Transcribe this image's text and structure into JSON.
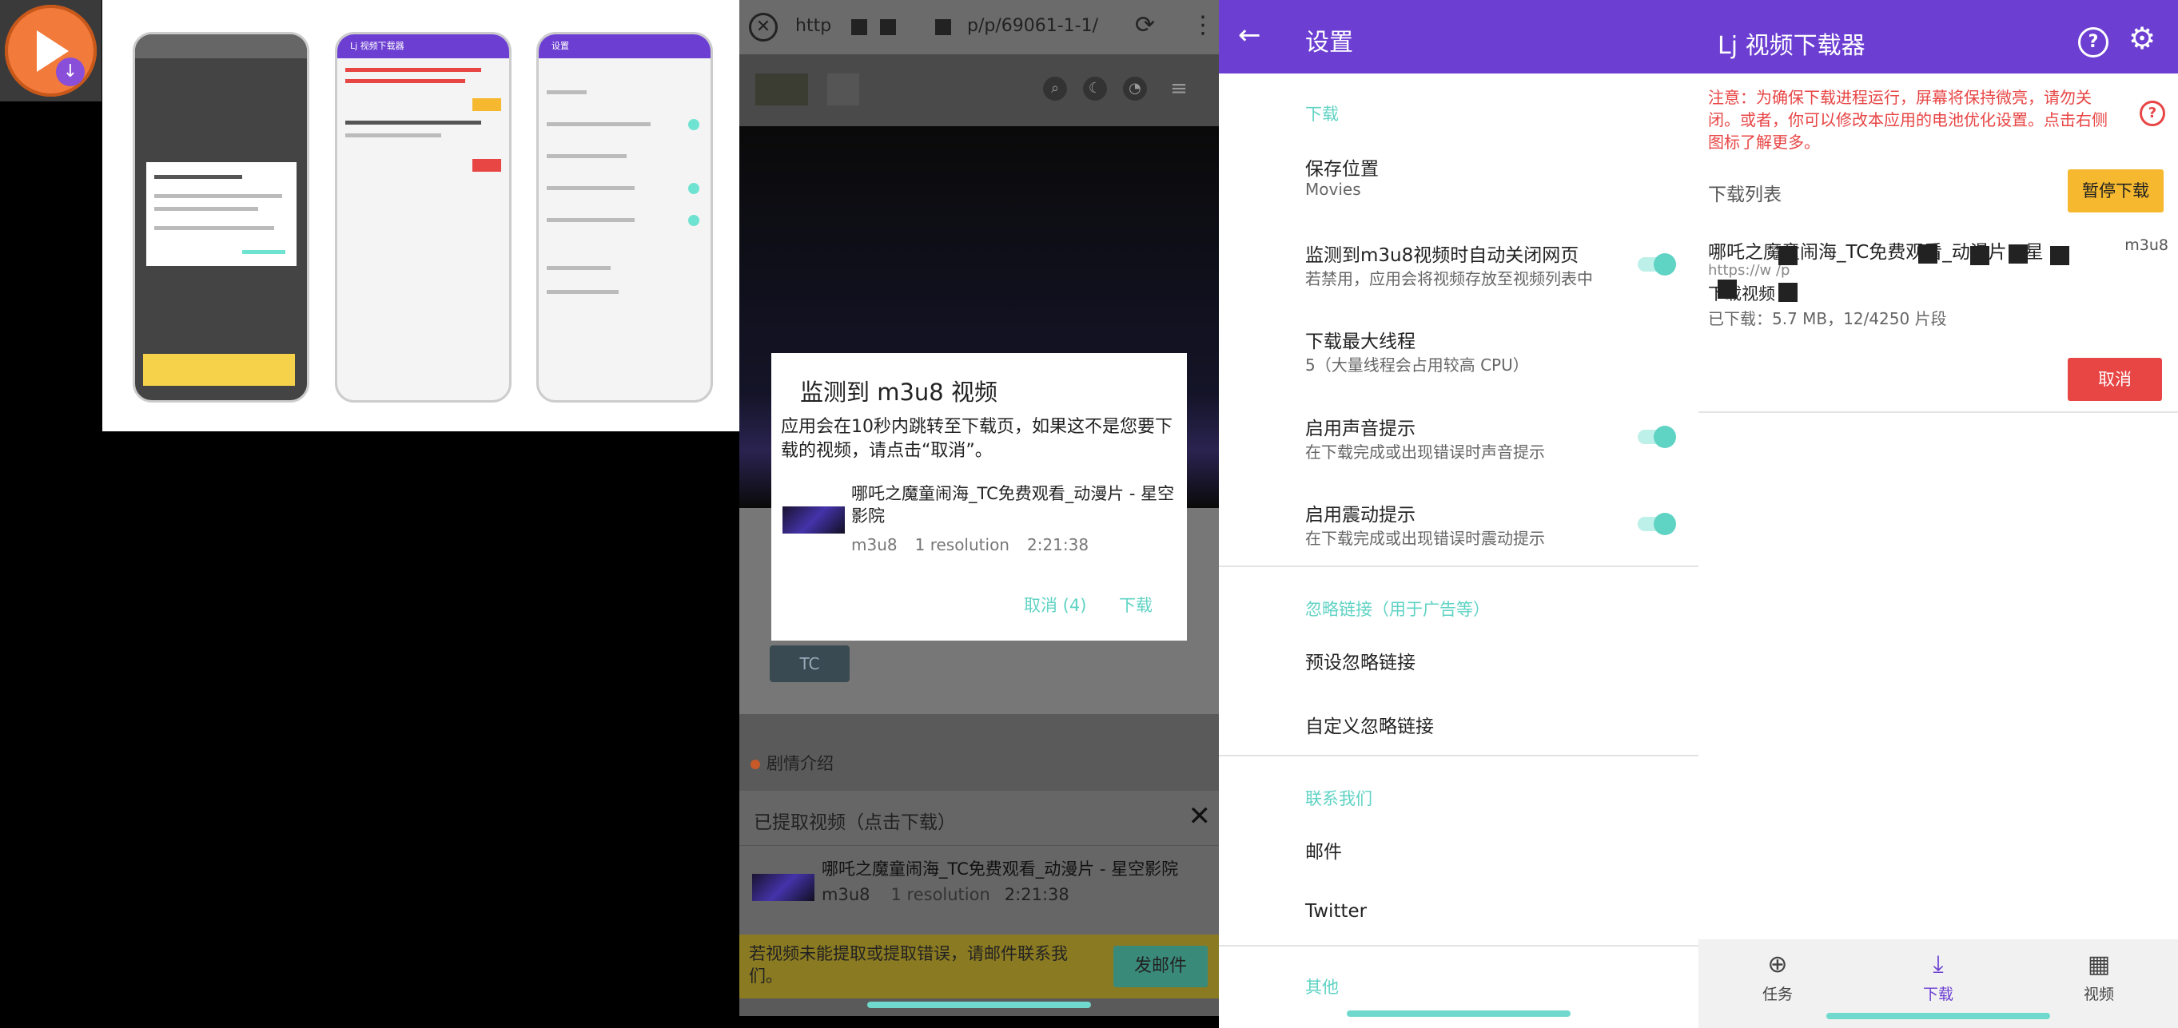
{
  "preview": {
    "p1_bar": "",
    "p2_bar": "Lj 视频下载器",
    "p3_bar": "设置"
  },
  "browser": {
    "url_prefix": "http",
    "url_suffix": "p/p/69061-1-1/",
    "tc_button": "TC",
    "synopsis": "剧情介绍",
    "extracted_header": "已提取视频（点击下载）",
    "video": {
      "title": "哪吒之魔童闹海_TC免费观看_动漫片 - 星空影院",
      "title_wrapped": "哪吒之魔童闹海_TC免费观看_动漫片 - 星空影院",
      "format": "m3u8",
      "resolution": "1 resolution",
      "duration": "2:21:38"
    },
    "warning": "若视频未能提取或提取错误，请邮件联系我们。",
    "email_button": "发邮件"
  },
  "dialog": {
    "title": "监测到 m3u8 视频",
    "message": "应用会在10秒内跳转至下载页，如果这不是您要下载的视频，请点击“取消”。",
    "cancel": "取消 (4)",
    "download": "下载"
  },
  "settings": {
    "title": "设置",
    "sections": {
      "download": "下载",
      "ignore": "忽略链接（用于广告等）",
      "contact": "联系我们",
      "other": "其他"
    },
    "items": {
      "save_location": {
        "title": "保存位置",
        "sub": "Movies"
      },
      "auto_close": {
        "title": "监测到m3u8视频时自动关闭网页",
        "sub": "若禁用，应用会将视频存放至视频列表中"
      },
      "max_threads": {
        "title": "下载最大线程",
        "sub": "5（大量线程会占用较高 CPU）"
      },
      "sound": {
        "title": "启用声音提示",
        "sub": "在下载完成或出现错误时声音提示"
      },
      "vibrate": {
        "title": "启用震动提示",
        "sub": "在下载完成或出现错误时震动提示"
      },
      "preset_ignore": {
        "title": "预设忽略链接"
      },
      "custom_ignore": {
        "title": "自定义忽略链接"
      },
      "email": {
        "title": "邮件"
      },
      "twitter": {
        "title": "Twitter"
      }
    }
  },
  "main": {
    "title": "Lj 视频下载器",
    "notice": "注意：为确保下载进程运行，屏幕将保持微亮，请勿关闭。或者，你可以修改本应用的电池优化设置。点击右侧图标了解更多。",
    "download_list": "下载列表",
    "pause_button": "暂停下载",
    "item": {
      "title": "哪吒之魔童闹海_TC免费观看_动漫片 - 星",
      "format": "m3u8",
      "url": "https://w          /p",
      "status": "下载视频",
      "progress": "已下载：5.7 MB，12/4250 片段"
    },
    "cancel_button": "取消",
    "nav": {
      "tasks": "任务",
      "download": "下载",
      "video": "视频"
    }
  },
  "colors": {
    "primary": "#6c3fd2",
    "accent": "#5fd3c4",
    "warning_red": "#e84545",
    "pause_yellow": "#f5b82e"
  },
  "icons": {
    "app": "play-download-icon",
    "close": "close-icon",
    "reload": "reload-icon",
    "more": "more-vert-icon",
    "back": "arrow-back-icon",
    "help": "help-circle-icon",
    "settings": "gear-icon",
    "tasks": "add-circle-icon",
    "download": "download-icon",
    "video": "film-icon"
  }
}
